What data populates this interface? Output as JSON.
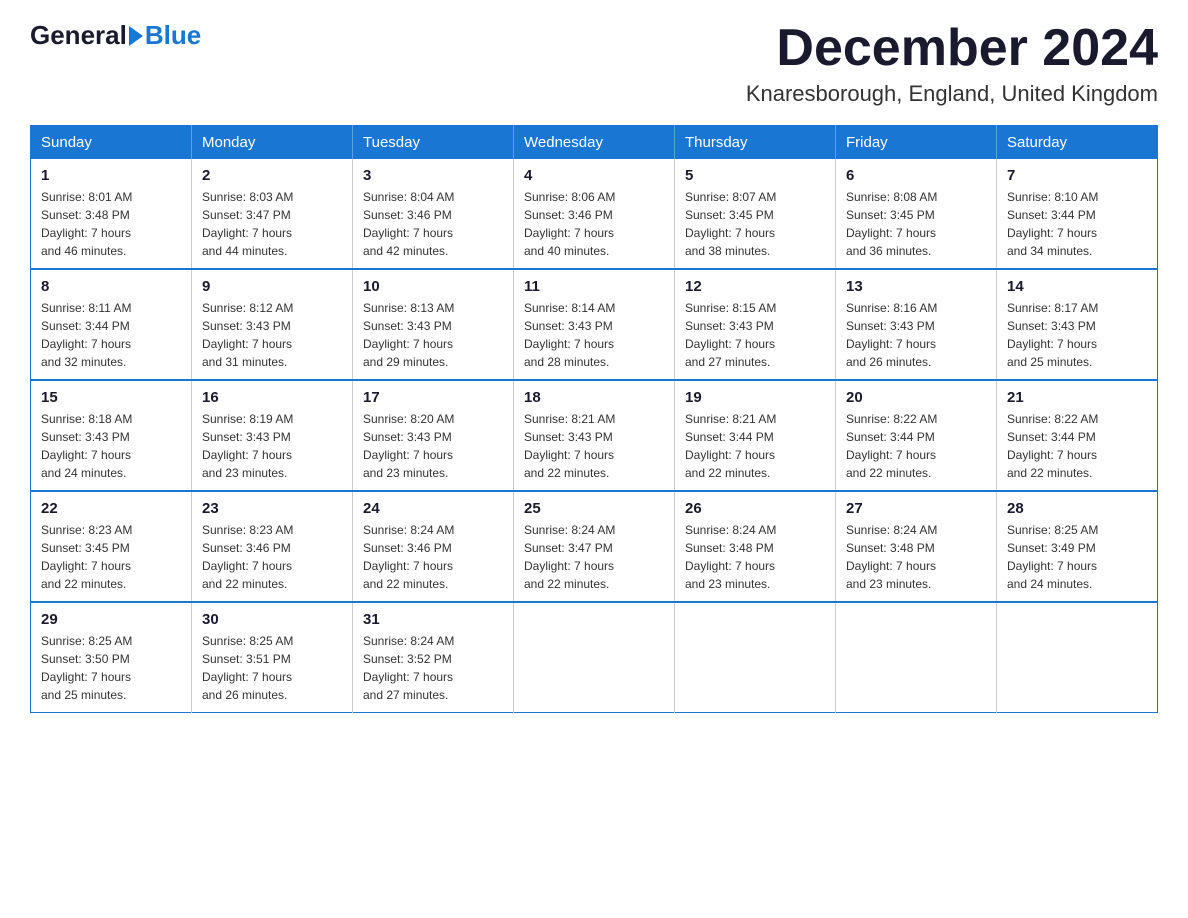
{
  "logo": {
    "general": "General",
    "blue": "Blue"
  },
  "title": {
    "month": "December 2024",
    "location": "Knaresborough, England, United Kingdom"
  },
  "weekdays": [
    "Sunday",
    "Monday",
    "Tuesday",
    "Wednesday",
    "Thursday",
    "Friday",
    "Saturday"
  ],
  "weeks": [
    [
      {
        "day": "1",
        "sunrise": "8:01 AM",
        "sunset": "3:48 PM",
        "daylight": "7 hours and 46 minutes."
      },
      {
        "day": "2",
        "sunrise": "8:03 AM",
        "sunset": "3:47 PM",
        "daylight": "7 hours and 44 minutes."
      },
      {
        "day": "3",
        "sunrise": "8:04 AM",
        "sunset": "3:46 PM",
        "daylight": "7 hours and 42 minutes."
      },
      {
        "day": "4",
        "sunrise": "8:06 AM",
        "sunset": "3:46 PM",
        "daylight": "7 hours and 40 minutes."
      },
      {
        "day": "5",
        "sunrise": "8:07 AM",
        "sunset": "3:45 PM",
        "daylight": "7 hours and 38 minutes."
      },
      {
        "day": "6",
        "sunrise": "8:08 AM",
        "sunset": "3:45 PM",
        "daylight": "7 hours and 36 minutes."
      },
      {
        "day": "7",
        "sunrise": "8:10 AM",
        "sunset": "3:44 PM",
        "daylight": "7 hours and 34 minutes."
      }
    ],
    [
      {
        "day": "8",
        "sunrise": "8:11 AM",
        "sunset": "3:44 PM",
        "daylight": "7 hours and 32 minutes."
      },
      {
        "day": "9",
        "sunrise": "8:12 AM",
        "sunset": "3:43 PM",
        "daylight": "7 hours and 31 minutes."
      },
      {
        "day": "10",
        "sunrise": "8:13 AM",
        "sunset": "3:43 PM",
        "daylight": "7 hours and 29 minutes."
      },
      {
        "day": "11",
        "sunrise": "8:14 AM",
        "sunset": "3:43 PM",
        "daylight": "7 hours and 28 minutes."
      },
      {
        "day": "12",
        "sunrise": "8:15 AM",
        "sunset": "3:43 PM",
        "daylight": "7 hours and 27 minutes."
      },
      {
        "day": "13",
        "sunrise": "8:16 AM",
        "sunset": "3:43 PM",
        "daylight": "7 hours and 26 minutes."
      },
      {
        "day": "14",
        "sunrise": "8:17 AM",
        "sunset": "3:43 PM",
        "daylight": "7 hours and 25 minutes."
      }
    ],
    [
      {
        "day": "15",
        "sunrise": "8:18 AM",
        "sunset": "3:43 PM",
        "daylight": "7 hours and 24 minutes."
      },
      {
        "day": "16",
        "sunrise": "8:19 AM",
        "sunset": "3:43 PM",
        "daylight": "7 hours and 23 minutes."
      },
      {
        "day": "17",
        "sunrise": "8:20 AM",
        "sunset": "3:43 PM",
        "daylight": "7 hours and 23 minutes."
      },
      {
        "day": "18",
        "sunrise": "8:21 AM",
        "sunset": "3:43 PM",
        "daylight": "7 hours and 22 minutes."
      },
      {
        "day": "19",
        "sunrise": "8:21 AM",
        "sunset": "3:44 PM",
        "daylight": "7 hours and 22 minutes."
      },
      {
        "day": "20",
        "sunrise": "8:22 AM",
        "sunset": "3:44 PM",
        "daylight": "7 hours and 22 minutes."
      },
      {
        "day": "21",
        "sunrise": "8:22 AM",
        "sunset": "3:44 PM",
        "daylight": "7 hours and 22 minutes."
      }
    ],
    [
      {
        "day": "22",
        "sunrise": "8:23 AM",
        "sunset": "3:45 PM",
        "daylight": "7 hours and 22 minutes."
      },
      {
        "day": "23",
        "sunrise": "8:23 AM",
        "sunset": "3:46 PM",
        "daylight": "7 hours and 22 minutes."
      },
      {
        "day": "24",
        "sunrise": "8:24 AM",
        "sunset": "3:46 PM",
        "daylight": "7 hours and 22 minutes."
      },
      {
        "day": "25",
        "sunrise": "8:24 AM",
        "sunset": "3:47 PM",
        "daylight": "7 hours and 22 minutes."
      },
      {
        "day": "26",
        "sunrise": "8:24 AM",
        "sunset": "3:48 PM",
        "daylight": "7 hours and 23 minutes."
      },
      {
        "day": "27",
        "sunrise": "8:24 AM",
        "sunset": "3:48 PM",
        "daylight": "7 hours and 23 minutes."
      },
      {
        "day": "28",
        "sunrise": "8:25 AM",
        "sunset": "3:49 PM",
        "daylight": "7 hours and 24 minutes."
      }
    ],
    [
      {
        "day": "29",
        "sunrise": "8:25 AM",
        "sunset": "3:50 PM",
        "daylight": "7 hours and 25 minutes."
      },
      {
        "day": "30",
        "sunrise": "8:25 AM",
        "sunset": "3:51 PM",
        "daylight": "7 hours and 26 minutes."
      },
      {
        "day": "31",
        "sunrise": "8:24 AM",
        "sunset": "3:52 PM",
        "daylight": "7 hours and 27 minutes."
      },
      null,
      null,
      null,
      null
    ]
  ]
}
